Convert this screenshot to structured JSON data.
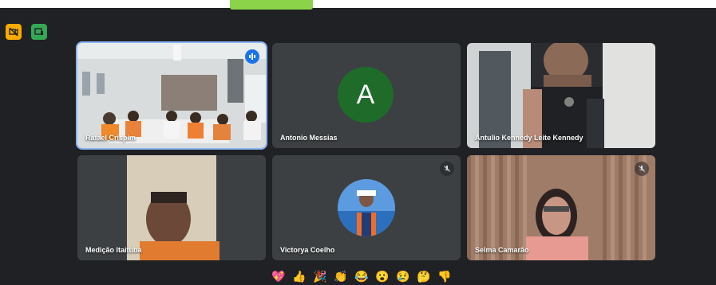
{
  "toolbar": {
    "camera_off_icon": "camera-off-icon",
    "screen_share_icon": "present-screen-icon"
  },
  "participants": [
    {
      "name": "Rafael Crispim",
      "state": "speaking"
    },
    {
      "name": "Antonio Messias",
      "avatar_letter": "A",
      "state": "normal"
    },
    {
      "name": "Antulio Kennedy Leite Kennedy",
      "state": "normal"
    },
    {
      "name": "Medição Itaituba",
      "state": "normal"
    },
    {
      "name": "Victorya Coelho",
      "state": "muted"
    },
    {
      "name": "Selma Camarão",
      "state": "muted"
    }
  ],
  "reactions": [
    "💖",
    "👍",
    "🎉",
    "👏",
    "😂",
    "😮",
    "😢",
    "🤔",
    "👎"
  ],
  "colors": {
    "background": "#202124",
    "tile": "#3c4043",
    "avatar_green": "#1e6b2a",
    "active_outline": "#8ab4f8",
    "camera_button": "#f9ab00",
    "share_button": "#34a853"
  }
}
